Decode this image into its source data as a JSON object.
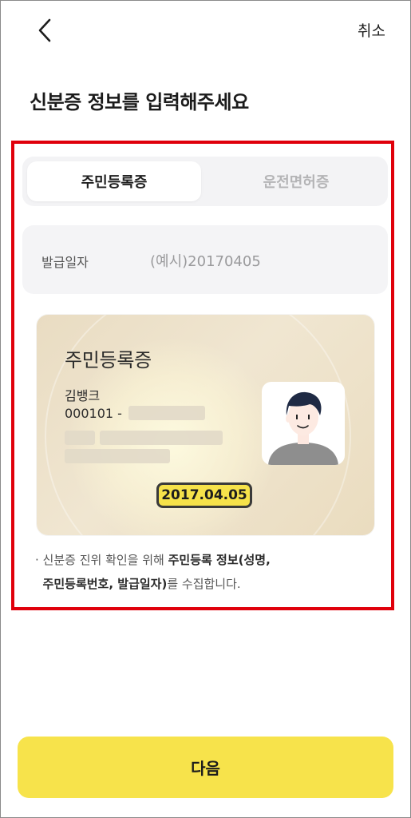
{
  "header": {
    "back_icon": "chevron-left-icon",
    "cancel_label": "취소"
  },
  "page": {
    "title": "신분증 정보를 입력해주세요"
  },
  "tabs": [
    {
      "label": "주민등록증",
      "selected": true
    },
    {
      "label": "운전면허증",
      "selected": false
    }
  ],
  "issue_date_field": {
    "label": "발급일자",
    "placeholder": "(예시)20170405",
    "value": ""
  },
  "id_card": {
    "title": "주민등록증",
    "name": "김뱅크",
    "number_prefix": "000101 -",
    "issue_date": "2017.04.05",
    "photo_icon": "person-avatar-icon"
  },
  "notice": {
    "part1": "· 신분증 진위 확인을 위해 ",
    "bold1": "주민등록 정보(성명,",
    "bold2": "주민등록번호, 발급일자)",
    "part2": "를 수집합니다."
  },
  "footer": {
    "next_label": "다음"
  },
  "colors": {
    "accent_yellow": "#F7E34B",
    "highlight_red": "#E0000B",
    "card_beige": "#EADCBF"
  }
}
